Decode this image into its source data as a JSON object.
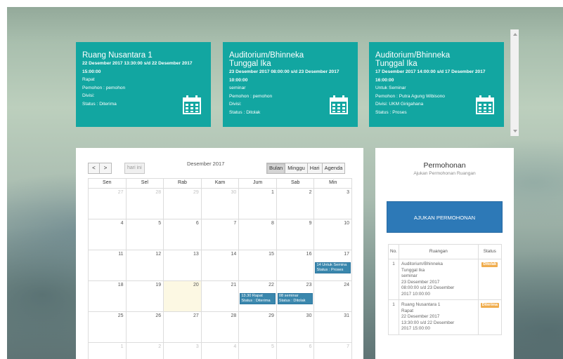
{
  "bookings": [
    {
      "room": "Ruang Nusantara 1",
      "date_range": "22 Desember 2017 13:30:00 s/d 22 Desember 2017 15:00:00",
      "activity": "Rapat",
      "applicant": "Pemohon : pemohon",
      "division": "Divisi:",
      "status": "Status : Diterima"
    },
    {
      "room": "Auditorium/Bhinneka Tunggal Ika",
      "date_range": "23 Desember 2017 08:00:00 s/d 23 Desember 2017 10:00:00",
      "activity": "seminar",
      "applicant": "Pemohon : pemohon",
      "division": "Divisi:",
      "status": "Status : Ditolak"
    },
    {
      "room": "Auditorium/Bhinneka Tunggal Ika",
      "date_range": "17 Desember 2017 14:00:00 s/d 17 Desember 2017 16:00:00",
      "activity": "Untuk Seminar",
      "applicant": "Pemohon : Putra Agung Wibisono",
      "division": "Divisi: UKM Girigahana",
      "status": "Status : Proses"
    }
  ],
  "calendar": {
    "prev_label": "<",
    "next_label": ">",
    "today_label": "hari ini",
    "title": "Desember 2017",
    "views": [
      "Bulan",
      "Minggu",
      "Hari",
      "Agenda"
    ],
    "active_view": "Bulan",
    "weekdays": [
      "Sen",
      "Sel",
      "Rab",
      "Kam",
      "Jum",
      "Sab",
      "Min"
    ],
    "weeks": [
      [
        {
          "d": "27",
          "other": true
        },
        {
          "d": "28",
          "other": true
        },
        {
          "d": "29",
          "other": true
        },
        {
          "d": "30",
          "other": true
        },
        {
          "d": "1"
        },
        {
          "d": "2"
        },
        {
          "d": "3"
        }
      ],
      [
        {
          "d": "4"
        },
        {
          "d": "5"
        },
        {
          "d": "6"
        },
        {
          "d": "7"
        },
        {
          "d": "8"
        },
        {
          "d": "9"
        },
        {
          "d": "10"
        }
      ],
      [
        {
          "d": "11"
        },
        {
          "d": "12"
        },
        {
          "d": "13"
        },
        {
          "d": "14"
        },
        {
          "d": "15"
        },
        {
          "d": "16"
        },
        {
          "d": "17",
          "event": [
            "14 Untuk Semina",
            "Status : Proses"
          ]
        }
      ],
      [
        {
          "d": "18"
        },
        {
          "d": "19"
        },
        {
          "d": "20",
          "today": true
        },
        {
          "d": "21"
        },
        {
          "d": "22",
          "event": [
            "13.30 Rapat",
            "Status : Diterima"
          ]
        },
        {
          "d": "23",
          "event": [
            "08 seminar",
            "Status : Ditolak"
          ]
        },
        {
          "d": "24"
        }
      ],
      [
        {
          "d": "25"
        },
        {
          "d": "26"
        },
        {
          "d": "27"
        },
        {
          "d": "28"
        },
        {
          "d": "29"
        },
        {
          "d": "30"
        },
        {
          "d": "31"
        }
      ],
      [
        {
          "d": "1",
          "other": true
        },
        {
          "d": "2",
          "other": true
        },
        {
          "d": "3",
          "other": true
        },
        {
          "d": "4",
          "other": true
        },
        {
          "d": "5",
          "other": true
        },
        {
          "d": "6",
          "other": true
        },
        {
          "d": "7",
          "other": true
        }
      ]
    ]
  },
  "request_panel": {
    "title": "Permohonan",
    "subtitle": "Ajukan Permohonan Ruangan",
    "submit_label": "AJUKAN PERMOHONAN",
    "table_headers": [
      "No.",
      "Ruangan",
      "Status"
    ],
    "rows": [
      {
        "no": "1",
        "lines": [
          "Auditorium/Bhinneka",
          "Tunggal Ika",
          "seminar",
          "23 Desember 2017",
          "08:00:00 s/d 23 Desember",
          "2017 10:00:00"
        ],
        "status": "Ditolak"
      },
      {
        "no": "1",
        "lines": [
          "Ruang Nusantara 1",
          "Rapat",
          "22 Desember 2017",
          "13:30:00 s/d 22 Desember",
          "2017 15:00:00"
        ],
        "status": "Diterima"
      }
    ]
  },
  "colors": {
    "card_teal": "#12a6a1",
    "event_blue": "#3a87ad",
    "button_blue": "#2d79b7",
    "badge_orange": "#f0ad4e",
    "today_highlight": "#fcf8e3"
  }
}
